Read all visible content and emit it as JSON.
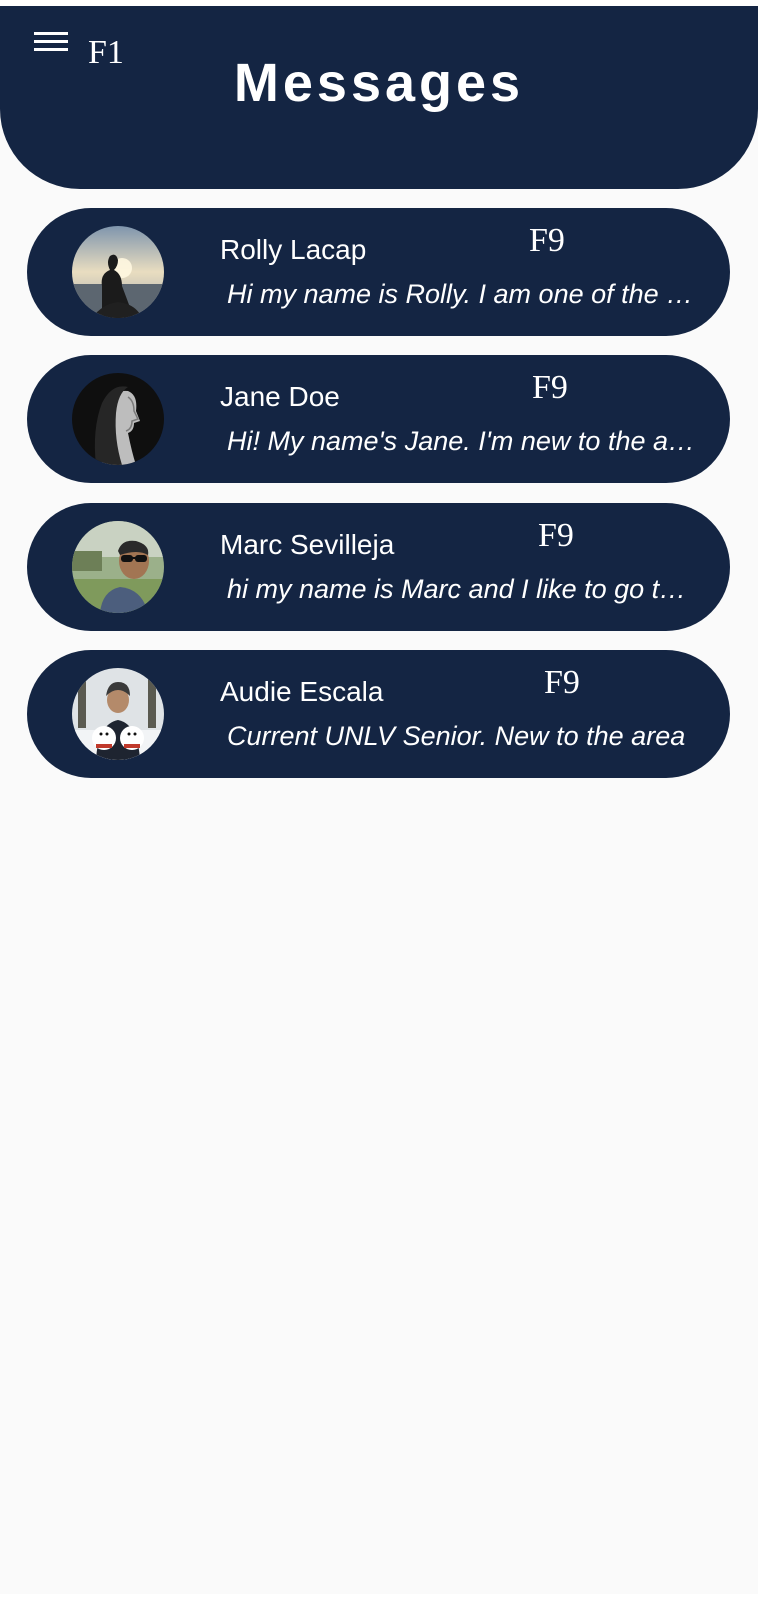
{
  "header": {
    "title": "Messages",
    "menu_marker": "F1"
  },
  "conversations": [
    {
      "name": "Rolly Lacap",
      "preview": "Hi my name is Rolly. I am one of the creators of this app",
      "marker": "F9",
      "avatar_icon": "avatar-photo-silhouette-sunset"
    },
    {
      "name": "Jane Doe",
      "preview": "Hi! My name's Jane. I'm new to the area",
      "marker": "F9",
      "avatar_icon": "avatar-photo-woman-profile"
    },
    {
      "name": "Marc Sevilleja",
      "preview": "hi my name is Marc and I like to go to the gym",
      "marker": "F9",
      "avatar_icon": "avatar-photo-man-sunglasses"
    },
    {
      "name": "Audie Escala",
      "preview": "Current UNLV Senior. New to the area",
      "marker": "F9",
      "avatar_icon": "avatar-photo-man-with-dogs"
    }
  ],
  "colors": {
    "primary": "#142543",
    "background": "#fafafa",
    "text_light": "#ffffff"
  }
}
